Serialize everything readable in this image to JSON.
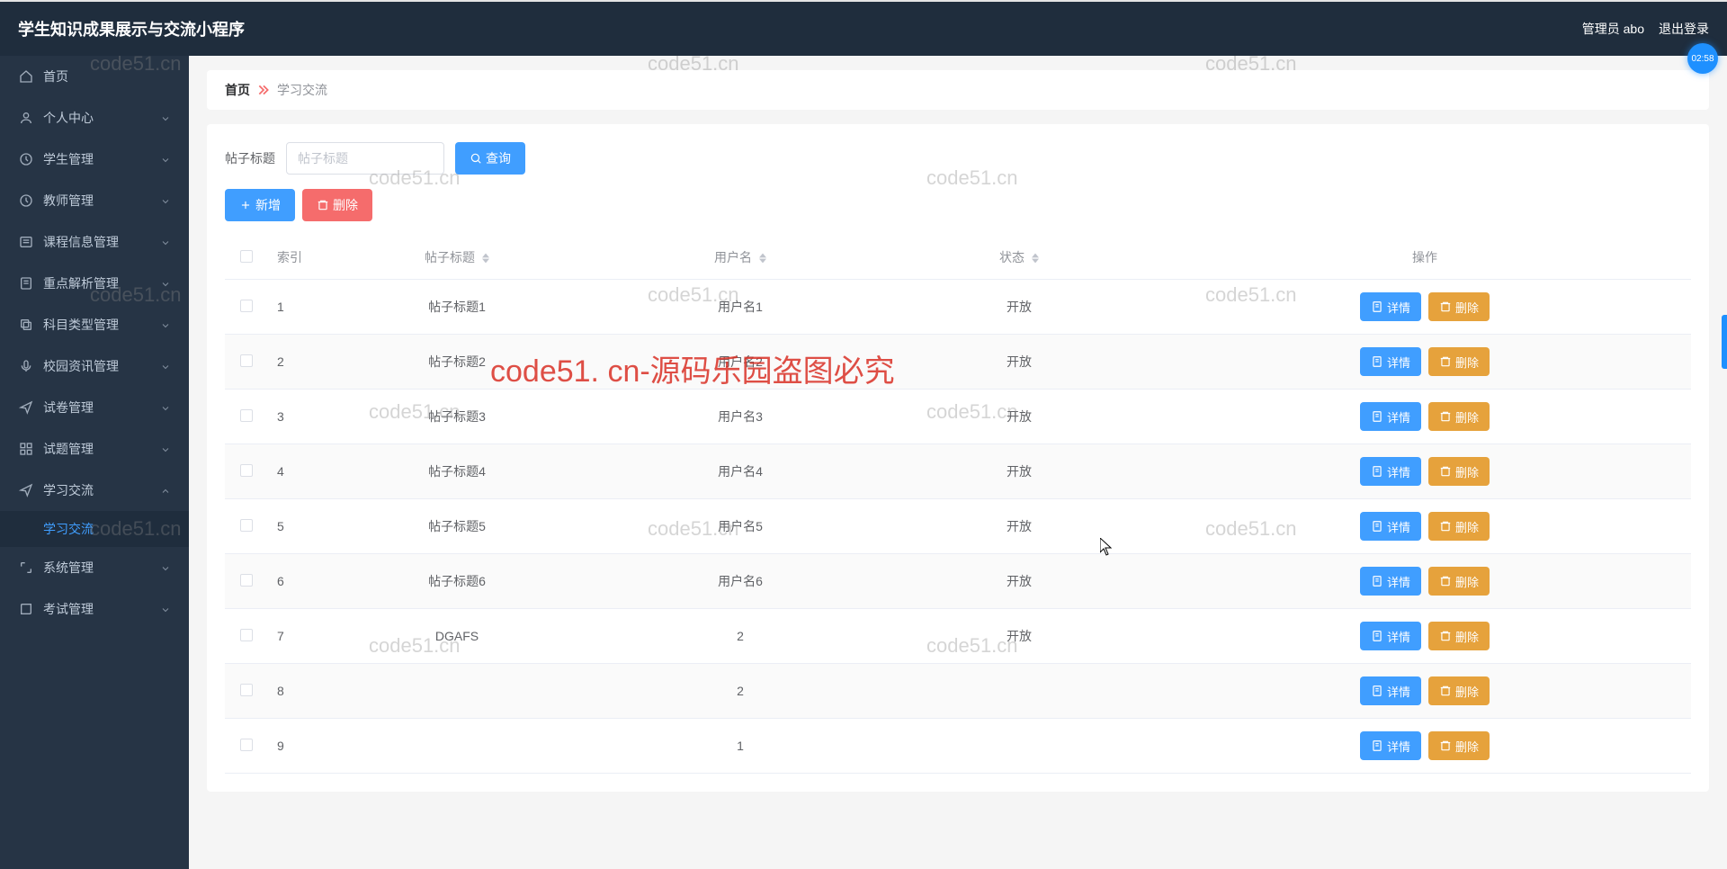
{
  "header": {
    "title": "学生知识成果展示与交流小程序",
    "user_label": "管理员 abo",
    "logout_label": "退出登录"
  },
  "timer": "02:58",
  "sidebar": {
    "items": [
      {
        "icon": "home",
        "label": "首页",
        "expandable": false
      },
      {
        "icon": "user",
        "label": "个人中心",
        "expandable": true
      },
      {
        "icon": "clock",
        "label": "学生管理",
        "expandable": true
      },
      {
        "icon": "clock",
        "label": "教师管理",
        "expandable": true
      },
      {
        "icon": "list",
        "label": "课程信息管理",
        "expandable": true
      },
      {
        "icon": "note",
        "label": "重点解析管理",
        "expandable": true
      },
      {
        "icon": "copy",
        "label": "科目类型管理",
        "expandable": true
      },
      {
        "icon": "mic",
        "label": "校园资讯管理",
        "expandable": true
      },
      {
        "icon": "send",
        "label": "试卷管理",
        "expandable": true
      },
      {
        "icon": "grid",
        "label": "试题管理",
        "expandable": true
      },
      {
        "icon": "send",
        "label": "学习交流",
        "expandable": true,
        "expanded": true
      },
      {
        "icon": "expand",
        "label": "系统管理",
        "expandable": true
      },
      {
        "icon": "book",
        "label": "考试管理",
        "expandable": true
      }
    ],
    "submenu_active": "学习交流"
  },
  "breadcrumb": {
    "home": "首页",
    "current": "学习交流"
  },
  "filter": {
    "label": "帖子标题",
    "placeholder": "帖子标题",
    "search_btn": "查询"
  },
  "actions": {
    "add": "新增",
    "delete": "删除"
  },
  "table": {
    "headers": {
      "index": "索引",
      "title": "帖子标题",
      "user": "用户名",
      "status": "状态",
      "ops": "操作"
    },
    "btn_detail": "详情",
    "btn_delete": "删除",
    "rows": [
      {
        "idx": "1",
        "title": "帖子标题1",
        "user": "用户名1",
        "status": "开放"
      },
      {
        "idx": "2",
        "title": "帖子标题2",
        "user": "用户名2",
        "status": "开放"
      },
      {
        "idx": "3",
        "title": "帖子标题3",
        "user": "用户名3",
        "status": "开放"
      },
      {
        "idx": "4",
        "title": "帖子标题4",
        "user": "用户名4",
        "status": "开放"
      },
      {
        "idx": "5",
        "title": "帖子标题5",
        "user": "用户名5",
        "status": "开放"
      },
      {
        "idx": "6",
        "title": "帖子标题6",
        "user": "用户名6",
        "status": "开放"
      },
      {
        "idx": "7",
        "title": "DGAFS",
        "user": "2",
        "status": "开放"
      },
      {
        "idx": "8",
        "title": "",
        "user": "2",
        "status": ""
      },
      {
        "idx": "9",
        "title": "",
        "user": "1",
        "status": ""
      }
    ]
  },
  "watermarks": {
    "small": "code51.cn",
    "big": "code51. cn-源码乐园盗图必究"
  }
}
